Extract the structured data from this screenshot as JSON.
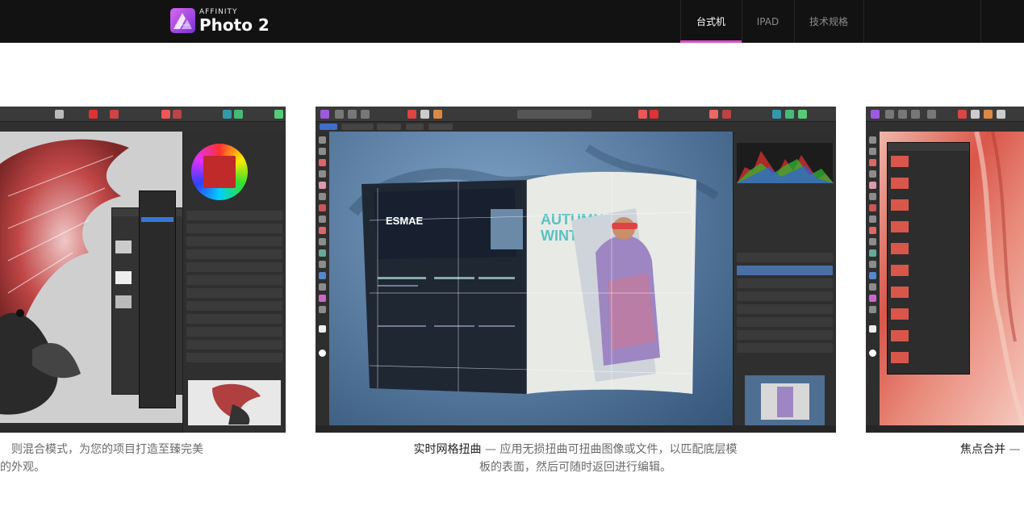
{
  "brand": {
    "small": "AFFINITY",
    "name": "Photo 2"
  },
  "nav": [
    {
      "label": "台式机",
      "active": true
    },
    {
      "label": "IPAD",
      "active": false
    },
    {
      "label": "技术规格",
      "active": false
    }
  ],
  "slides": [
    {
      "caption_line1": "则混合模式，为您的项目打造至臻完美",
      "caption_line2": "的外观。"
    },
    {
      "caption_highlight": "实时网格扭曲",
      "caption_line1_rest": " — 应用无损扭曲可扭曲图像或文件，以匹配底层模",
      "caption_line2": "板的表面，然后可随时返回进行编辑。"
    },
    {
      "caption_highlight": "焦点合并",
      "caption_line1_rest": " —"
    }
  ],
  "colors": {
    "topbar": "#121212",
    "accent": "#d94fc9"
  }
}
